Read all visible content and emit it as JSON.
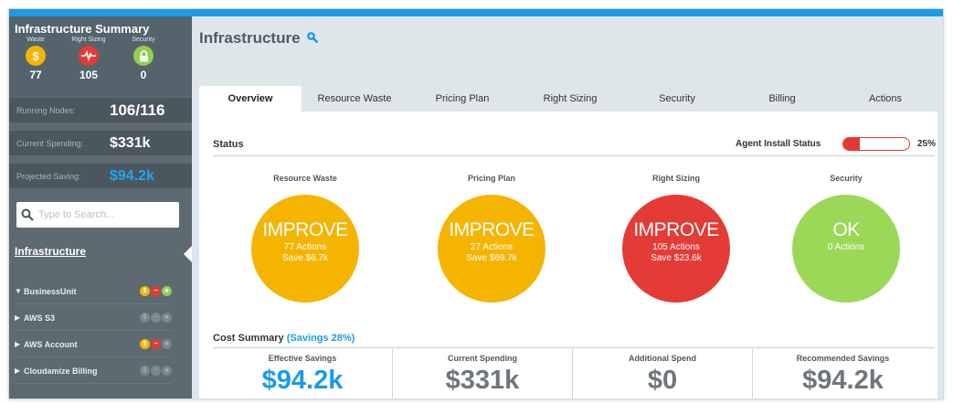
{
  "summary": {
    "title": "Infrastructure Summary",
    "waste": {
      "label": "Waste",
      "icon": "dollar-icon",
      "symbol": "$",
      "count": "77",
      "color": "#f5b400"
    },
    "right_sizing": {
      "label": "Right Sizing",
      "icon": "heartbeat-icon",
      "count": "105",
      "color": "#e43b36"
    },
    "security": {
      "label": "Security",
      "icon": "lock-icon",
      "count": "0",
      "color": "#8fd14f"
    }
  },
  "stats": {
    "running_nodes": {
      "label": "Running Nodes:",
      "value": "106/116"
    },
    "current_spending": {
      "label": "Current Spending:",
      "value": "$331k"
    },
    "projected_saving": {
      "label": "Projected Saving:",
      "value": "$94.2k"
    }
  },
  "search": {
    "placeholder": "Type to Search...",
    "value": ""
  },
  "nav": {
    "infrastructure_link": "Infrastructure",
    "tree": [
      {
        "label": "BusinessUnit",
        "expanded": true,
        "dots": "colored"
      },
      {
        "label": "AWS S3",
        "expanded": false,
        "dots": "gray"
      },
      {
        "label": "AWS Account",
        "expanded": false,
        "dots": "colored"
      },
      {
        "label": "Cloudamize Billing",
        "expanded": false,
        "dots": "gray"
      }
    ]
  },
  "main": {
    "title": "Infrastructure",
    "title_icon": "settings-icon",
    "tabs": [
      "Overview",
      "Resource Waste",
      "Pricing Plan",
      "Right Sizing",
      "Security",
      "Billing",
      "Actions"
    ],
    "active_tab": "Overview"
  },
  "status": {
    "title": "Status",
    "agent_label": "Agent Install Status",
    "agent_percent": 25,
    "agent_percent_text": "25%",
    "gauges": [
      {
        "label": "Resource Waste",
        "status": "IMPROVE",
        "actions": "77 Actions",
        "save": "Save $6.7k",
        "color": "yellow"
      },
      {
        "label": "Pricing Plan",
        "status": "IMPROVE",
        "actions": "27 Actions",
        "save": "Save $69.7k",
        "color": "yellow"
      },
      {
        "label": "Right Sizing",
        "status": "IMPROVE",
        "actions": "105 Actions",
        "save": "Save $23.6k",
        "color": "red"
      },
      {
        "label": "Security",
        "status": "OK",
        "actions": "0 Actions",
        "save": "",
        "color": "green"
      }
    ]
  },
  "cost": {
    "title": "Cost Summary",
    "savings_pct": "(Savings 28%)",
    "items": [
      {
        "label": "Effective Savings",
        "value": "$94.2k",
        "highlight": true
      },
      {
        "label": "Current Spending",
        "value": "$331k",
        "highlight": false
      },
      {
        "label": "Additional Spend",
        "value": "$0",
        "highlight": false
      },
      {
        "label": "Recommended Savings",
        "value": "$94.2k",
        "highlight": false
      }
    ]
  },
  "colors": {
    "accent": "#1a9be8",
    "yellow": "#f5b400",
    "red": "#e43b36",
    "green": "#9bd857",
    "sidebar": "#5d6a72"
  }
}
